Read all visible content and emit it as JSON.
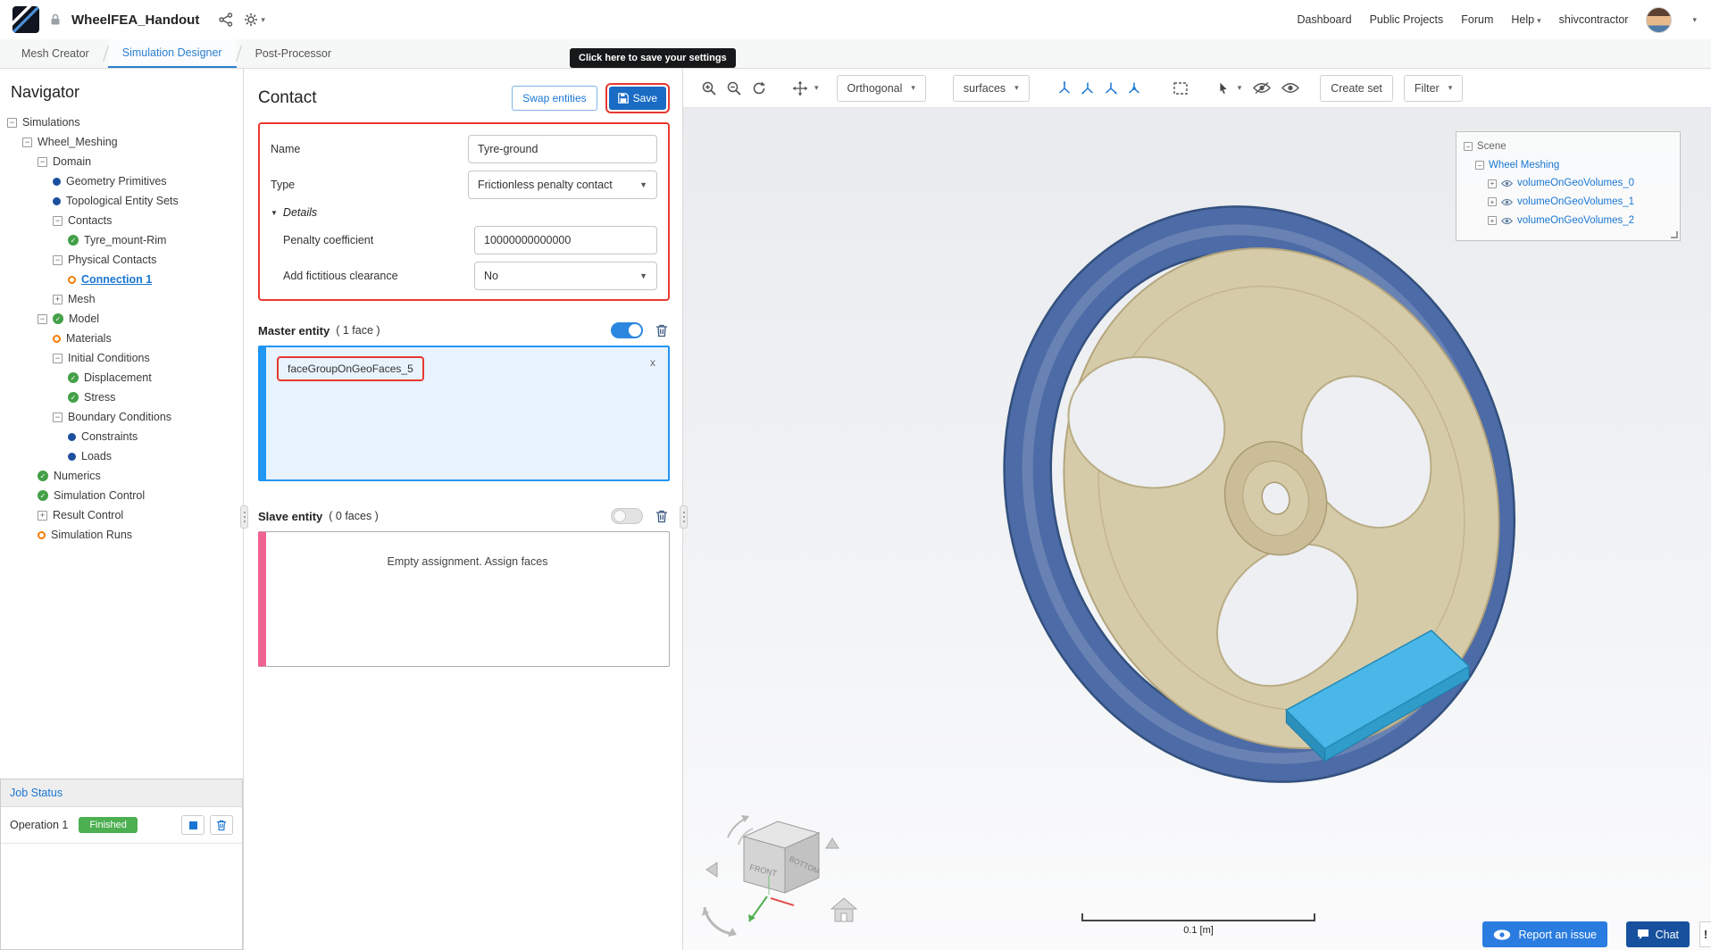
{
  "header": {
    "title": "WheelFEA_Handout",
    "links": [
      "Dashboard",
      "Public Projects",
      "Forum",
      "Help"
    ],
    "username": "shivcontractor"
  },
  "tabs": {
    "items": [
      "Mesh Creator",
      "Simulation Designer",
      "Post-Processor"
    ],
    "active_index": 1
  },
  "tooltip_text": "Click here to save your settings",
  "navigator": {
    "title": "Navigator",
    "tree": [
      {
        "label": "Simulations",
        "level": 0,
        "expander": "minus",
        "status": null,
        "selected": false
      },
      {
        "label": "Wheel_Meshing",
        "level": 1,
        "expander": "minus",
        "status": null,
        "selected": false
      },
      {
        "label": "Domain",
        "level": 2,
        "expander": "minus",
        "status": null,
        "selected": false
      },
      {
        "label": "Geometry Primitives",
        "level": 3,
        "expander": null,
        "status": "blue",
        "selected": false
      },
      {
        "label": "Topological Entity Sets",
        "level": 3,
        "expander": null,
        "status": "blue",
        "selected": false
      },
      {
        "label": "Contacts",
        "level": 3,
        "expander": "minus",
        "status": null,
        "selected": false
      },
      {
        "label": "Tyre_mount-Rim",
        "level": 4,
        "expander": null,
        "status": "check",
        "selected": false
      },
      {
        "label": "Physical Contacts",
        "level": 3,
        "expander": "minus",
        "status": null,
        "selected": false
      },
      {
        "label": "Connection 1",
        "level": 4,
        "expander": null,
        "status": "orange",
        "selected": true
      },
      {
        "label": "Mesh",
        "level": 3,
        "expander": "plus",
        "status": null,
        "selected": false
      },
      {
        "label": "Model",
        "level": 2,
        "expander": "minus",
        "status": "check",
        "selected": false
      },
      {
        "label": "Materials",
        "level": 3,
        "expander": null,
        "status": "orange",
        "selected": false
      },
      {
        "label": "Initial Conditions",
        "level": 3,
        "expander": "minus",
        "status": null,
        "selected": false
      },
      {
        "label": "Displacement",
        "level": 4,
        "expander": null,
        "status": "check",
        "selected": false
      },
      {
        "label": "Stress",
        "level": 4,
        "expander": null,
        "status": "check",
        "selected": false
      },
      {
        "label": "Boundary Conditions",
        "level": 3,
        "expander": "minus",
        "status": null,
        "selected": false
      },
      {
        "label": "Constraints",
        "level": 4,
        "expander": null,
        "status": "blue",
        "selected": false
      },
      {
        "label": "Loads",
        "level": 4,
        "expander": null,
        "status": "blue",
        "selected": false
      },
      {
        "label": "Numerics",
        "level": 2,
        "expander": null,
        "status": "check",
        "selected": false
      },
      {
        "label": "Simulation Control",
        "level": 2,
        "expander": null,
        "status": "check",
        "selected": false
      },
      {
        "label": "Result Control",
        "level": 2,
        "expander": "plus",
        "status": null,
        "selected": false
      },
      {
        "label": "Simulation Runs",
        "level": 2,
        "expander": null,
        "status": "orange",
        "selected": false
      }
    ],
    "job_status": {
      "title": "Job Status",
      "operation": "Operation 1",
      "badge": "Finished"
    }
  },
  "contact": {
    "title": "Contact",
    "swap_label": "Swap entities",
    "save_label": "Save",
    "name_label": "Name",
    "name_value": "Tyre-ground",
    "type_label": "Type",
    "type_value": "Frictionless penalty contact",
    "details_label": "Details",
    "penalty_label": "Penalty coefficient",
    "penalty_value": "10000000000000",
    "clearance_label": "Add fictitious clearance",
    "clearance_value": "No",
    "master_label": "Master entity",
    "master_count": "( 1 face )",
    "master_assignment": "faceGroupOnGeoFaces_5",
    "remove_label": "x",
    "slave_label": "Slave entity",
    "slave_count": "( 0 faces )",
    "slave_empty": "Empty assignment. Assign faces"
  },
  "viewport": {
    "orthogonal_label": "Orthogonal",
    "surfaces_label": "surfaces",
    "create_set_label": "Create set",
    "filter_label": "Filter",
    "scene_tree": {
      "root": "Scene",
      "group": "Wheel Meshing",
      "volumes": [
        "volumeOnGeoVolumes_0",
        "volumeOnGeoVolumes_1",
        "volumeOnGeoVolumes_2"
      ]
    },
    "cube_front": "FRONT",
    "cube_bottom": "BOTTOM",
    "scale_label": "0.1 [m]",
    "report_label": "Report an issue",
    "chat_label": "Chat",
    "alert_label": "!"
  },
  "colors": {
    "accent_blue": "#1976d2",
    "active_tab_blue": "#2a7fd0",
    "save_blue": "#1a6bc4",
    "toggle_on_blue": "#2b87e0",
    "master_stripe": "#2196f3",
    "slave_stripe": "#f06292",
    "finished_green": "#4caf50",
    "annotation_red": "#e8382f",
    "tyre_blue": "#4d6ba6",
    "rim_tan": "#d6cba9",
    "plate_cyan": "#49b8e8"
  }
}
